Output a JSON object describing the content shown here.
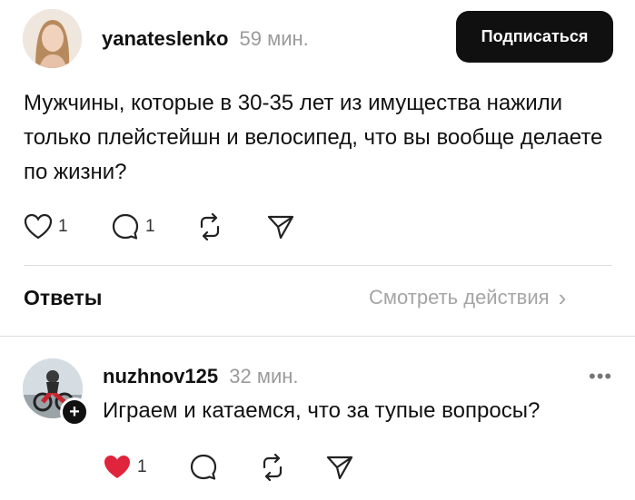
{
  "post": {
    "username": "yanateslenko",
    "time": "59 мин.",
    "follow_label": "Подписаться",
    "text": "Мужчины, которые в 30-35 лет из имущества нажили только плейстейшн и велосипед, что вы вообще делаете по жизни?",
    "like_count": "1",
    "comment_count": "1",
    "icons": [
      "heart-icon",
      "comment-icon",
      "repost-icon",
      "share-icon"
    ]
  },
  "replies_section": {
    "label": "Ответы",
    "activity_label": "Смотреть действия",
    "activity_chevron": "›"
  },
  "reply": {
    "username": "nuzhnov125",
    "time": "32 мин.",
    "text": "Играем и катаемся, что за тупые вопросы?",
    "like_count": "1",
    "more_label": "•••",
    "like_color": "#e0243c",
    "icons": [
      "heart-filled-icon",
      "comment-icon",
      "repost-icon",
      "share-icon"
    ]
  }
}
